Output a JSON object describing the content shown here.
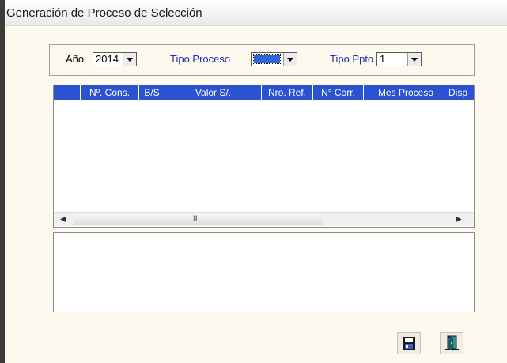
{
  "window": {
    "title": "Generación de Proceso de Selección"
  },
  "filters": {
    "anio_label": "Año",
    "anio_value": "2014",
    "tipo_proceso_label": "Tipo Proceso",
    "tipo_proceso_value": "",
    "tipo_ppto_label": "Tipo Ppto",
    "tipo_ppto_value": "1"
  },
  "grid": {
    "columns": [
      "",
      "Nº. Cons.",
      "B/S",
      "Valor S/.",
      "Nro. Ref.",
      "N° Corr.",
      "Mes Proceso",
      "Disp"
    ],
    "rows": [],
    "scroll_thumb_label": "III"
  },
  "memo": {
    "value": ""
  },
  "toolbar": {
    "icons": [
      "save-icon",
      "exit-door-icon"
    ]
  },
  "colors": {
    "header_bg": "#2a52d1",
    "label_blue": "#1f2bb0",
    "window_bg": "#fdf9ee"
  }
}
